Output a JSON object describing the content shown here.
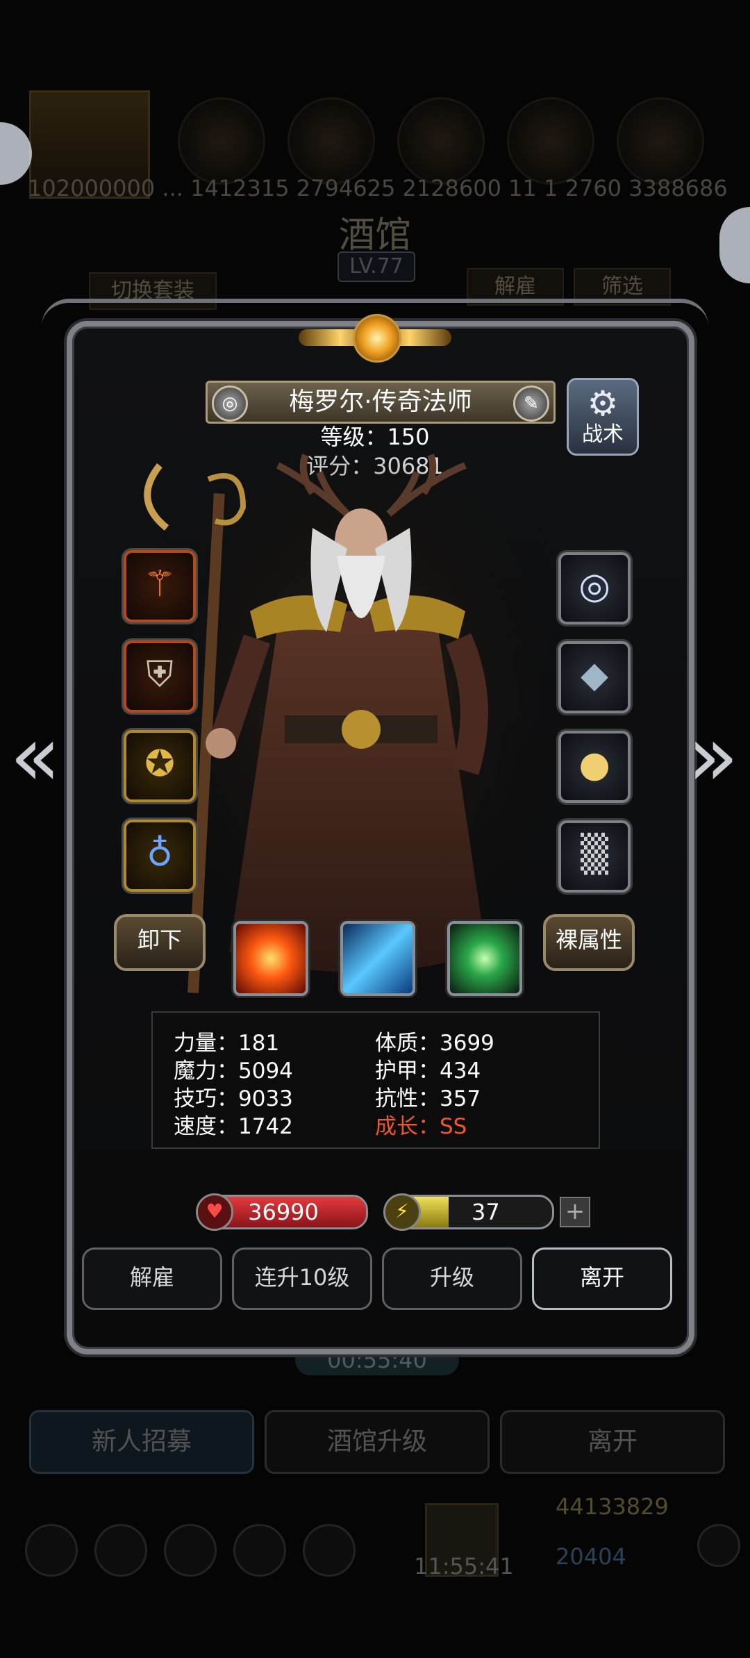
{
  "background": {
    "number_strip": "102000000 ... 1412315 2794625 2128600 11 1 2760 3388686",
    "title": "酒馆",
    "level_badge": "LV.77",
    "switch_outfit_label": "切换套装",
    "dismiss_label": "解雇",
    "filter_label": "筛选",
    "timer": "00:55:40",
    "tabs": [
      {
        "label": "新人招募"
      },
      {
        "label": "酒馆升级"
      },
      {
        "label": "离开"
      }
    ],
    "gold": "44133829",
    "gems": "20404",
    "clock": "11:55:41"
  },
  "hero": {
    "name": "梅罗尔·传奇法师",
    "level_line": "等级：150",
    "score_line": "评分：30681",
    "tactics_label": "战术"
  },
  "equipment": {
    "left": [
      {
        "icon": "staff-icon",
        "rarity": "red"
      },
      {
        "icon": "armor-icon",
        "rarity": "red"
      },
      {
        "icon": "medallion-icon",
        "rarity": "gold"
      },
      {
        "icon": "amulet-icon",
        "rarity": "gold"
      }
    ],
    "right": [
      {
        "icon": "swirl-orb-icon",
        "rarity": "grey"
      },
      {
        "icon": "crystal-rock-icon",
        "rarity": "grey"
      },
      {
        "icon": "lantern-icon",
        "rarity": "grey"
      },
      {
        "icon": "chainmail-icon",
        "rarity": "grey"
      }
    ]
  },
  "actions": {
    "unequip": "卸下",
    "base_attributes": "裸属性"
  },
  "skills": [
    {
      "icon": "fire-burst-icon"
    },
    {
      "icon": "ice-shards-icon"
    },
    {
      "icon": "green-crystal-icon"
    }
  ],
  "stats": {
    "strength": "力量：181",
    "magic": "魔力：5094",
    "skill": "技巧：9033",
    "speed": "速度：1742",
    "constitution": "体质：3699",
    "armor": "护甲：434",
    "resistance": "抗性：357",
    "growth": "成长：SS"
  },
  "bars": {
    "hp_value": "36990",
    "hp_fill": 1.0,
    "energy_value": "37",
    "energy_fill": 0.37
  },
  "buttons": {
    "dismiss": "解雇",
    "level_up_10": "连升10级",
    "level_up": "升级",
    "leave": "离开"
  },
  "colors": {
    "growth": "#f0582a",
    "hp": "#c0282c",
    "energy": "#d8c432"
  }
}
